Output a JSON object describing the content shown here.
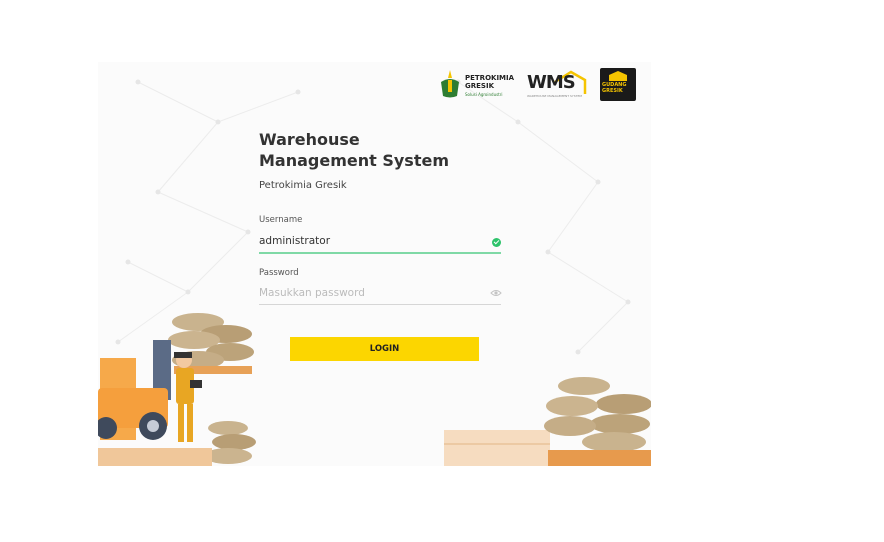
{
  "logos": {
    "petrokimia": {
      "line1": "PETROKIMIA",
      "line2": "GRESIK",
      "tagline": "Solusi Agroindustri"
    },
    "wms": {
      "text": "WMS",
      "tagline": "WAREHOUSE MANAGEMENT SYSTEM"
    },
    "gudang": {
      "line1": "GUDANG",
      "line2": "GRESIK"
    }
  },
  "form": {
    "title_line1": "Warehouse",
    "title_line2": "Management System",
    "subtitle": "Petrokimia Gresik",
    "username_label": "Username",
    "username_value": "administrator",
    "password_label": "Password",
    "password_placeholder": "Masukkan password",
    "login_label": "LOGIN"
  },
  "colors": {
    "accent": "#fcd600",
    "valid": "#2ec36b"
  }
}
